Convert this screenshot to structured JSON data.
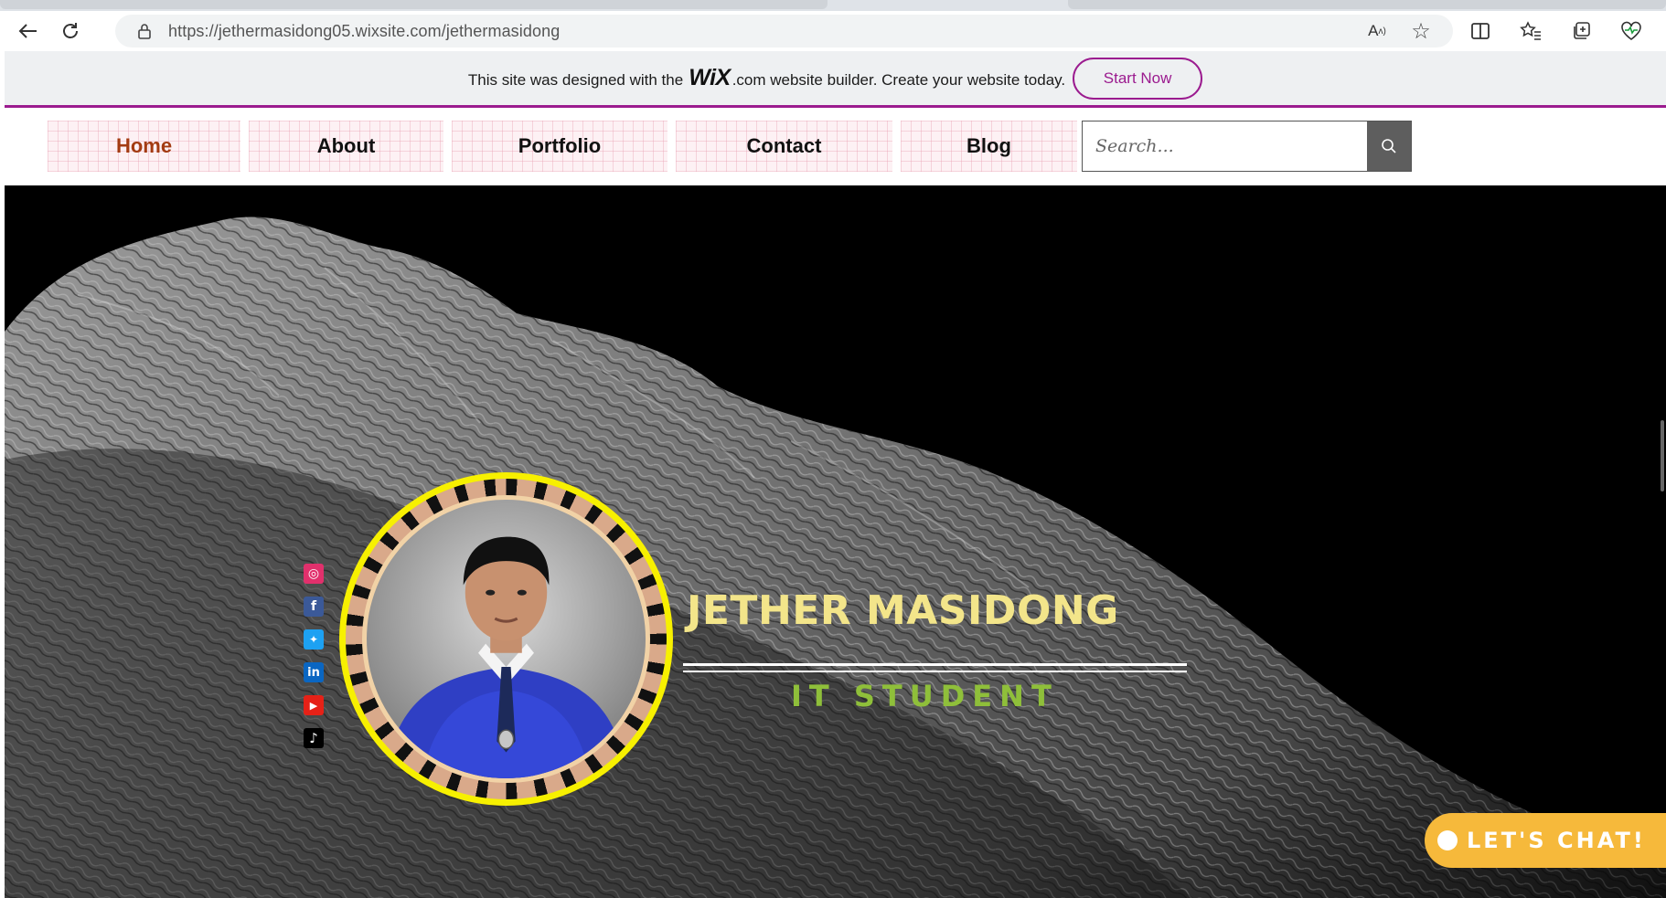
{
  "browser": {
    "url_host": "https://jethermasidong05.wixsite.com/",
    "url_path": "jethermasidong",
    "icons": [
      "back-icon",
      "refresh-icon",
      "lock-icon",
      "read-aloud-icon",
      "favorite-star-icon",
      "split-screen-icon",
      "favorites-icon",
      "collections-icon",
      "health-icon"
    ]
  },
  "wix_banner": {
    "text_before": "This site was designed with the",
    "logo": "WiX",
    "text_after": ".com website builder. Create your website today.",
    "cta": "Start Now",
    "accent_color": "#9b1b8f"
  },
  "nav": {
    "items": [
      {
        "label": "Home",
        "active": true
      },
      {
        "label": "About",
        "active": false
      },
      {
        "label": "Portfolio",
        "active": false
      },
      {
        "label": "Contact",
        "active": false
      },
      {
        "label": "Blog",
        "active": false
      }
    ],
    "search_placeholder": "Search..."
  },
  "hero": {
    "name": "JETHER MASIDONG",
    "role": "IT STUDENT",
    "name_color": "#f3e58a",
    "role_color": "#8fbf3a",
    "socials": [
      {
        "name": "instagram-icon",
        "glyph": "◎",
        "color": "#e1306c"
      },
      {
        "name": "facebook-icon",
        "glyph": "f",
        "color": "#3b5998"
      },
      {
        "name": "twitter-icon",
        "glyph": "✦",
        "color": "#1da1f2"
      },
      {
        "name": "linkedin-icon",
        "glyph": "in",
        "color": "#0a66c2"
      },
      {
        "name": "youtube-icon",
        "glyph": "▶",
        "color": "#e62117"
      },
      {
        "name": "tiktok-icon",
        "glyph": "♪",
        "color": "#000000"
      }
    ]
  },
  "chat": {
    "label": "LET'S CHAT!",
    "color": "#f6b93b"
  }
}
